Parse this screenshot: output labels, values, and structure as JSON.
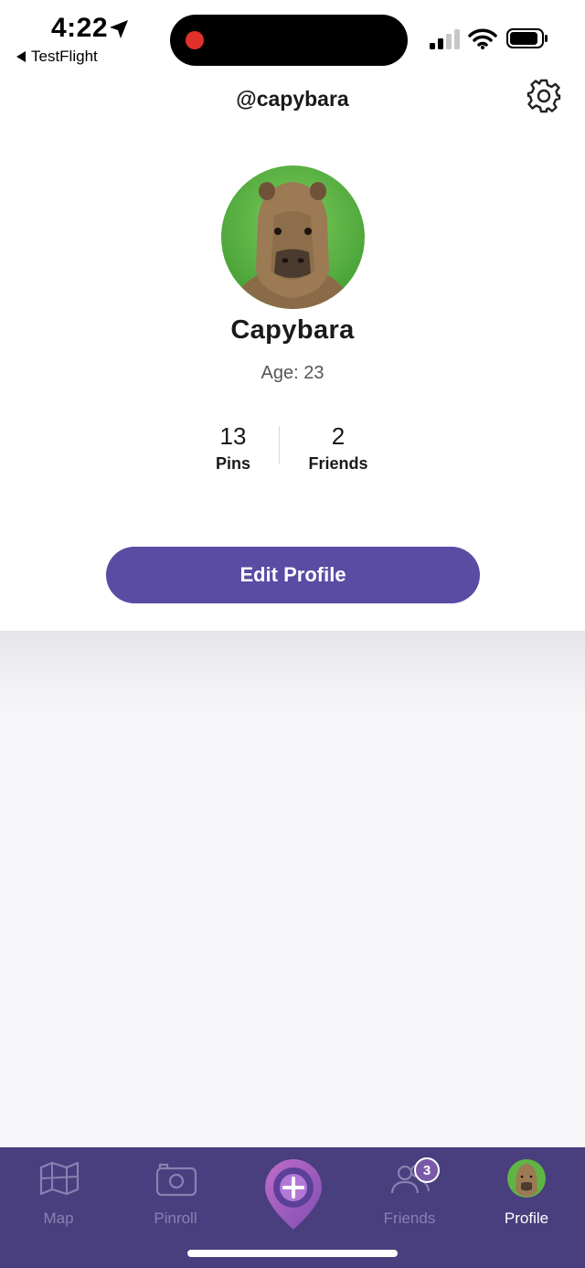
{
  "status_bar": {
    "time": "4:22",
    "back_app": "TestFlight"
  },
  "header": {
    "username": "@capybara"
  },
  "profile": {
    "display_name": "Capybara",
    "age_label": "Age:",
    "age_value": "23",
    "stats": [
      {
        "value": "13",
        "label": "Pins"
      },
      {
        "value": "2",
        "label": "Friends"
      }
    ],
    "edit_button_label": "Edit Profile"
  },
  "tab_bar": {
    "tabs": [
      {
        "label": "Map",
        "icon": "map-icon",
        "active": false
      },
      {
        "label": "Pinroll",
        "icon": "camera-icon",
        "active": false
      },
      {
        "label": "",
        "icon": "add-pin-icon",
        "active": false
      },
      {
        "label": "Friends",
        "icon": "friends-icon",
        "active": false,
        "badge": "3"
      },
      {
        "label": "Profile",
        "icon": "avatar",
        "active": true
      }
    ]
  },
  "colors": {
    "accent": "#5a4ba3",
    "tab_bar_bg": "#493e7e",
    "tab_inactive": "#8a81b2",
    "recording_dot": "#e0312a"
  }
}
